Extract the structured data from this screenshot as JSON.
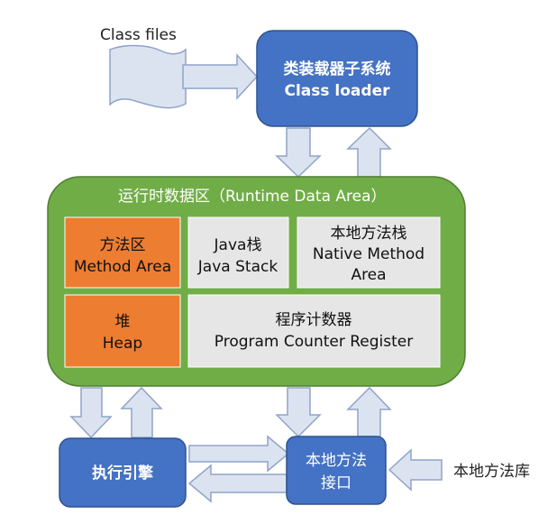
{
  "source": {
    "label": "Class files"
  },
  "class_loader": {
    "line1": "类装载器子系统",
    "line2": "Class loader"
  },
  "runtime_data_area": {
    "title": "运行时数据区（Runtime Data Area）",
    "method_area": {
      "line1": "方法区",
      "line2": "Method Area"
    },
    "java_stack": {
      "line1": "Java栈",
      "line2": "Java Stack"
    },
    "native_method_stack": {
      "line1": "本地方法栈",
      "line2": "Native Method",
      "line3": "Area"
    },
    "heap": {
      "line1": "堆",
      "line2": "Heap"
    },
    "pc_register": {
      "line1": "程序计数器",
      "line2": "Program Counter Register"
    }
  },
  "execution_engine": {
    "label": "执行引擎"
  },
  "native_interface": {
    "line1": "本地方法",
    "line2": "接口"
  },
  "native_library": {
    "label": "本地方法库"
  },
  "colors": {
    "blue_box": "#4472C4",
    "blue_border": "#2F528F",
    "green_area": "#70AD47",
    "green_border": "#507E32",
    "orange_box": "#ED7D31",
    "gray_box": "#E7E6E6",
    "arrow_fill": "#DCE3F0",
    "arrow_stroke": "#8FA4C8"
  }
}
